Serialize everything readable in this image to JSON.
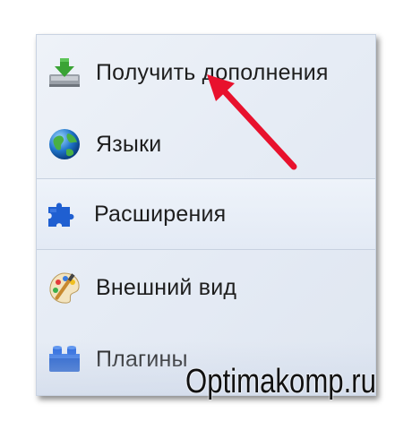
{
  "menu": {
    "items": [
      {
        "label": "Получить дополнения",
        "icon": "download-tray-icon",
        "selected": false
      },
      {
        "label": "Языки",
        "icon": "globe-icon",
        "selected": false
      },
      {
        "label": "Расширения",
        "icon": "puzzle-piece-icon",
        "selected": true
      },
      {
        "label": "Внешний вид",
        "icon": "palette-brush-icon",
        "selected": false
      },
      {
        "label": "Плагины",
        "icon": "lego-brick-icon",
        "selected": false
      }
    ]
  },
  "annotation": {
    "arrow_color": "#e8112d",
    "points_to": "Получить дополнения"
  },
  "watermark": {
    "text": "Optimakomp.ru"
  },
  "colors": {
    "panel_bg": "#e6ecf5",
    "selected_bg": "#e3eaf5",
    "text": "#1e1e1e"
  }
}
